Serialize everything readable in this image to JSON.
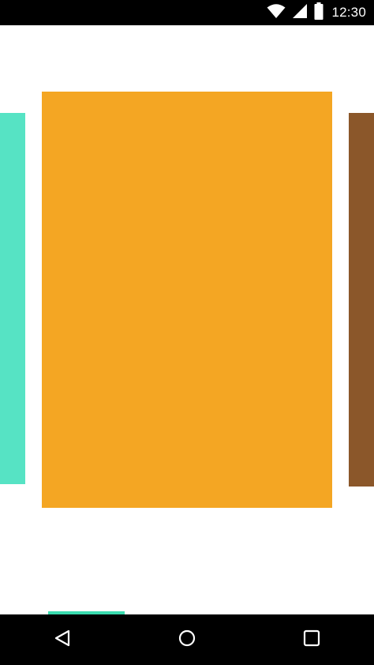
{
  "status_bar": {
    "time": "12:30",
    "icons": [
      "wifi-icon",
      "cellular-signal-icon",
      "battery-icon"
    ]
  },
  "pager": {
    "pages": [
      {
        "name": "previous",
        "color": "#56E3C4"
      },
      {
        "name": "current",
        "color": "#F4A623"
      },
      {
        "name": "next",
        "color": "#8B572A"
      }
    ],
    "indicator_color": "#3ADBAF"
  },
  "nav_bar": {
    "buttons": [
      "back-icon",
      "home-icon",
      "recents-icon"
    ]
  }
}
